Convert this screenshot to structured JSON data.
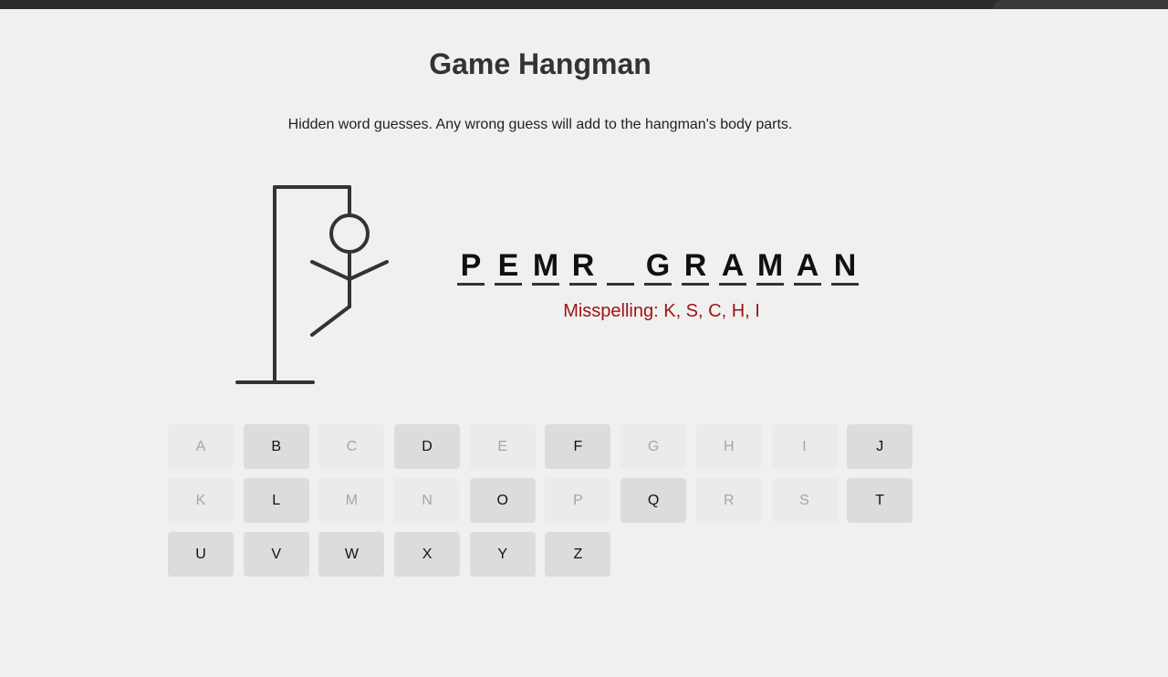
{
  "game": {
    "title": "Game Hangman",
    "instructions": "Hidden word guesses. Any wrong guess will add to the hangman's body parts.",
    "word_letters": [
      "P",
      "E",
      "M",
      "R",
      "",
      "G",
      "R",
      "A",
      "M",
      "A",
      "N"
    ],
    "wrong_guesses_text": "Misspelling: K, S, C, H, I",
    "wrong_guesses": [
      "K",
      "S",
      "C",
      "H",
      "I"
    ],
    "wrong_count": 5
  },
  "keyboard": {
    "keys": [
      {
        "label": "A",
        "used": true
      },
      {
        "label": "B",
        "used": false
      },
      {
        "label": "C",
        "used": true
      },
      {
        "label": "D",
        "used": false
      },
      {
        "label": "E",
        "used": true
      },
      {
        "label": "F",
        "used": false
      },
      {
        "label": "G",
        "used": true
      },
      {
        "label": "H",
        "used": true
      },
      {
        "label": "I",
        "used": true
      },
      {
        "label": "J",
        "used": false
      },
      {
        "label": "K",
        "used": true
      },
      {
        "label": "L",
        "used": false
      },
      {
        "label": "M",
        "used": true
      },
      {
        "label": "N",
        "used": true
      },
      {
        "label": "O",
        "used": false
      },
      {
        "label": "P",
        "used": true
      },
      {
        "label": "Q",
        "used": false
      },
      {
        "label": "R",
        "used": true
      },
      {
        "label": "S",
        "used": true
      },
      {
        "label": "T",
        "used": false
      },
      {
        "label": "U",
        "used": false
      },
      {
        "label": "V",
        "used": false
      },
      {
        "label": "W",
        "used": false
      },
      {
        "label": "X",
        "used": false
      },
      {
        "label": "Y",
        "used": false
      },
      {
        "label": "Z",
        "used": false
      }
    ]
  },
  "colors": {
    "background": "#f0f0f0",
    "figure": "#333333",
    "wrong_text": "#a01414",
    "key_active": "#dcdcdc",
    "key_used": "#ebebeb"
  }
}
